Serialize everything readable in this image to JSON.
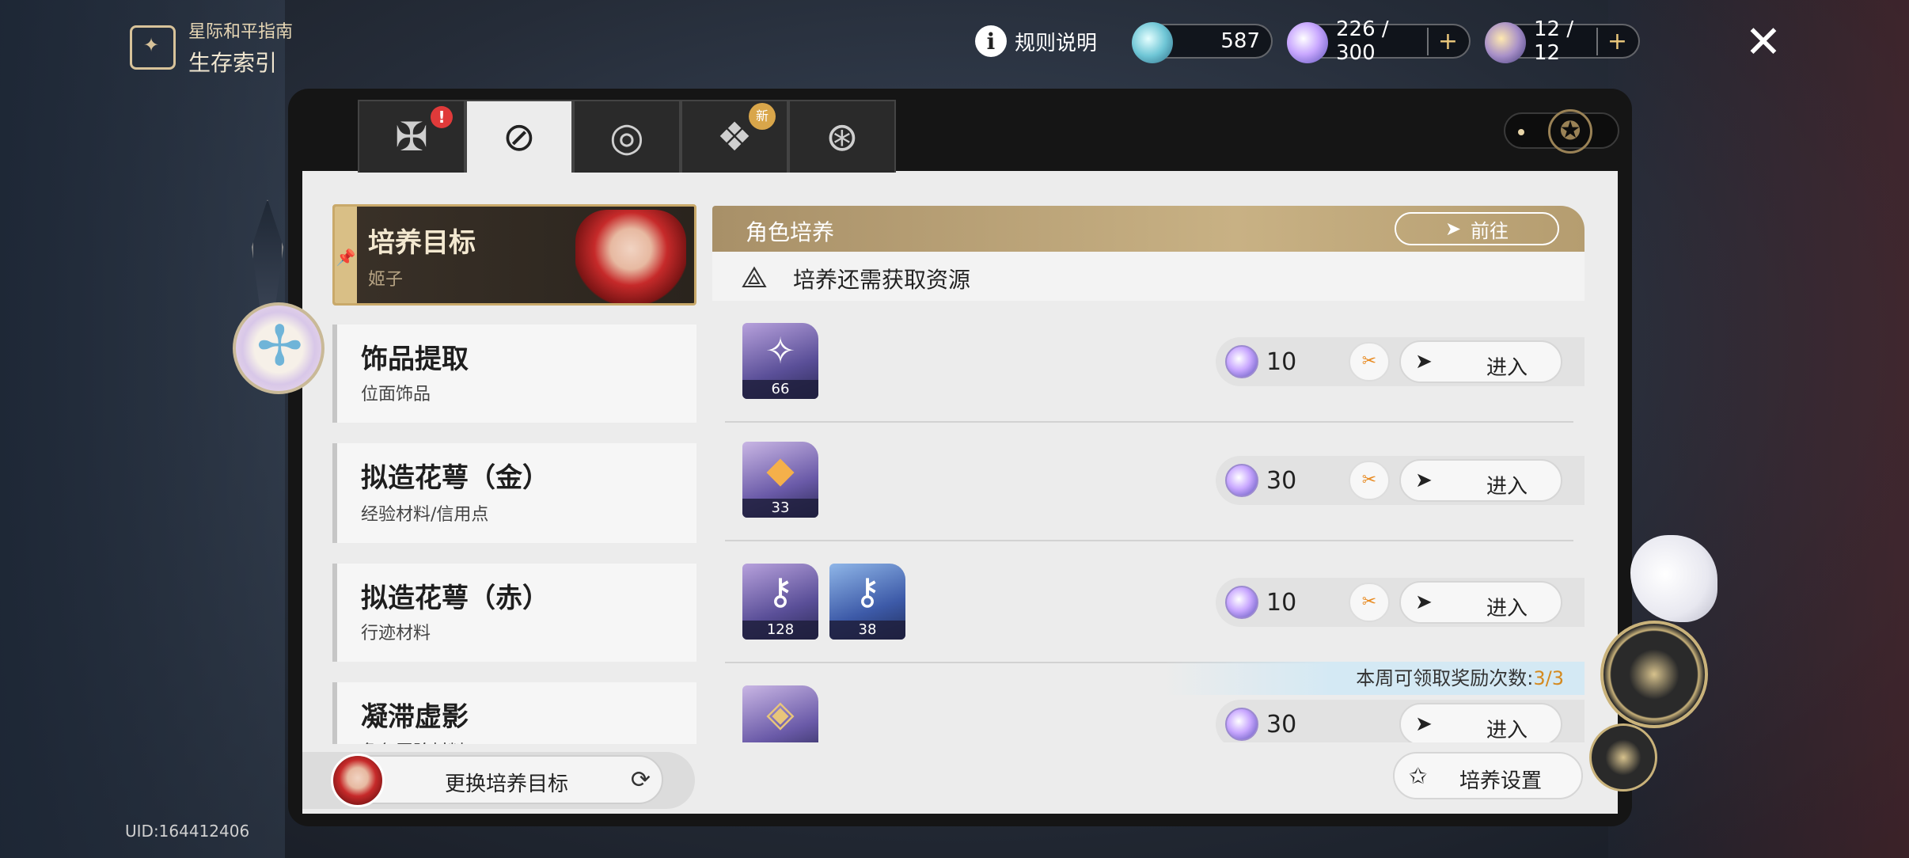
{
  "brand": {
    "subtitle": "星际和平指南",
    "title": "生存索引"
  },
  "topbar": {
    "rule_label": "规则说明",
    "currency_1": {
      "value": "587",
      "icon": "stellar-jade-icon"
    },
    "currency_2": {
      "value": "226 / 300",
      "icon": "trailblaze-power-icon"
    },
    "currency_3": {
      "value": "12 / 12",
      "icon": "fuel-icon"
    },
    "plus": "+"
  },
  "tabs": [
    {
      "name": "tab-daily",
      "icon": "✠",
      "badge": "!"
    },
    {
      "name": "tab-survival",
      "icon": "⊘",
      "active": true
    },
    {
      "name": "tab-planets",
      "icon": "◎"
    },
    {
      "name": "tab-rewards",
      "icon": "❖",
      "badge": "新"
    },
    {
      "name": "tab-misc",
      "icon": "⊛"
    }
  ],
  "left": {
    "target": {
      "title": "培养目标",
      "subtitle": "姬子"
    },
    "items": [
      {
        "title": "饰品提取",
        "subtitle": "位面饰品"
      },
      {
        "title": "拟造花萼（金）",
        "subtitle": "经验材料/信用点"
      },
      {
        "title": "拟造花萼（赤）",
        "subtitle": "行迹材料"
      },
      {
        "title": "凝滞虚影",
        "subtitle": "角色晋阶材料"
      }
    ],
    "switch_label": "更换培养目标"
  },
  "right": {
    "section_title": "角色培养",
    "goto_label": "前往",
    "subheader": "培养还需获取资源",
    "rows": [
      {
        "items": [
          {
            "count": "66"
          }
        ],
        "cost": "10",
        "enter": "进入",
        "ticket": true
      },
      {
        "items": [
          {
            "count": "33"
          }
        ],
        "cost": "30",
        "enter": "进入",
        "ticket": true
      },
      {
        "items": [
          {
            "count": "128"
          },
          {
            "count": "38"
          }
        ],
        "cost": "10",
        "enter": "进入",
        "ticket": true
      },
      {
        "items": [
          {
            "count": ""
          }
        ],
        "cost": "30",
        "enter": "进入",
        "ticket": false
      }
    ],
    "weekly_label": "本周可领取奖励次数:",
    "weekly_value": "3/3",
    "settings_label": "培养设置"
  },
  "uid": "UID:164412406"
}
